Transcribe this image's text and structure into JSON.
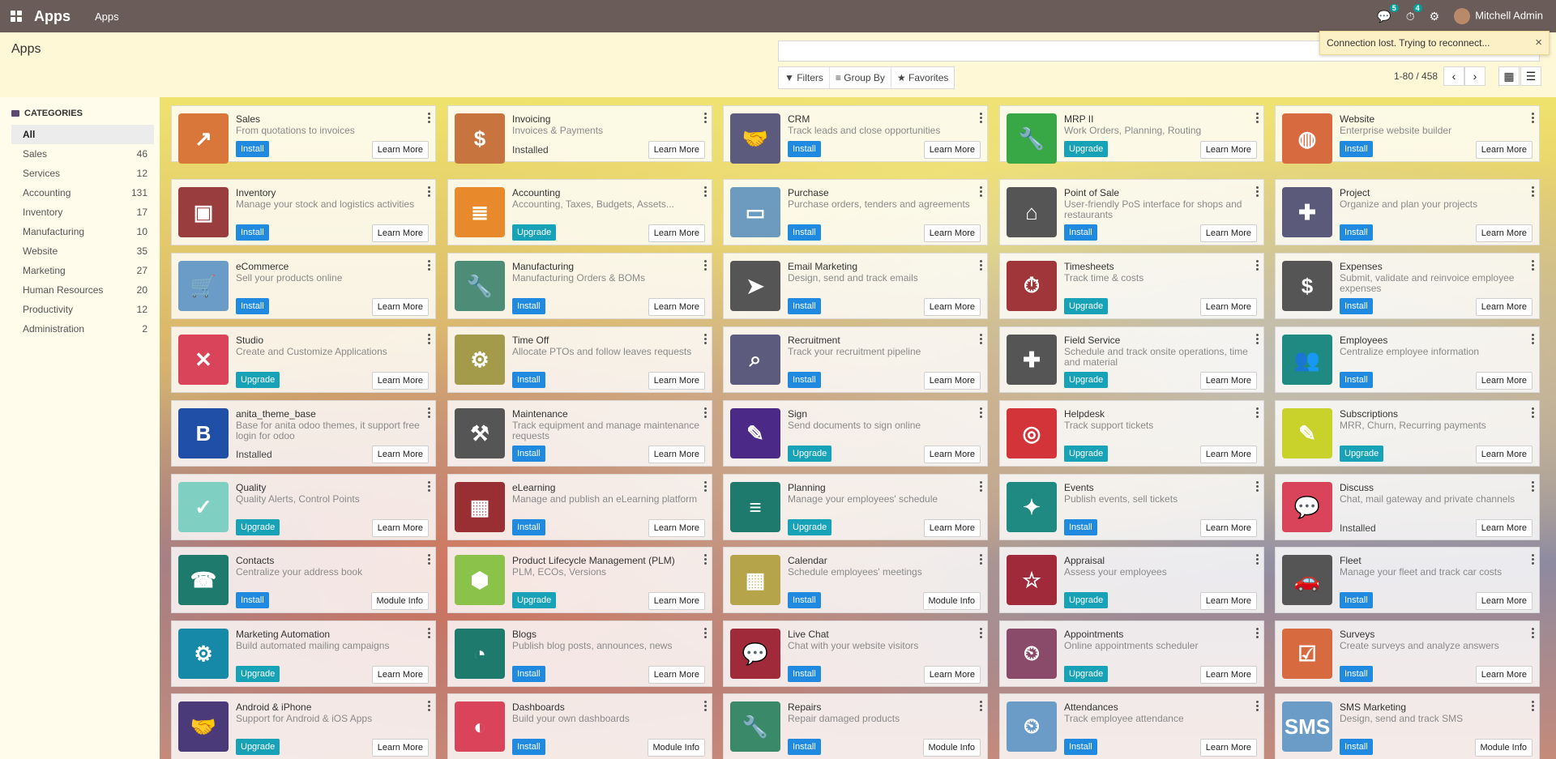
{
  "topbar": {
    "app_name": "Apps",
    "menu": "Apps",
    "messages_count": "5",
    "activities_count": "4",
    "user": "Mitchell Admin"
  },
  "control": {
    "title": "Apps",
    "filters": "Filters",
    "group_by": "Group By",
    "favorites": "Favorites",
    "pager": "1-80 / 458"
  },
  "toast": {
    "text": "Connection lost. Trying to reconnect..."
  },
  "sidebar": {
    "title": "CATEGORIES",
    "items": [
      {
        "label": "All",
        "count": ""
      },
      {
        "label": "Sales",
        "count": "46"
      },
      {
        "label": "Services",
        "count": "12"
      },
      {
        "label": "Accounting",
        "count": "131"
      },
      {
        "label": "Inventory",
        "count": "17"
      },
      {
        "label": "Manufacturing",
        "count": "10"
      },
      {
        "label": "Website",
        "count": "35"
      },
      {
        "label": "Marketing",
        "count": "27"
      },
      {
        "label": "Human Resources",
        "count": "20"
      },
      {
        "label": "Productivity",
        "count": "12"
      },
      {
        "label": "Administration",
        "count": "2"
      }
    ]
  },
  "apps": [
    {
      "name": "Sales",
      "desc": "From quotations to invoices",
      "action": "Install",
      "info": "Learn More",
      "color": "#d9763a",
      "icon": "chart-icon",
      "glyph": "↗"
    },
    {
      "name": "Invoicing",
      "desc": "Invoices & Payments",
      "action": "Installed",
      "info": "Learn More",
      "color": "#c8743f",
      "icon": "invoice-icon",
      "glyph": "$"
    },
    {
      "name": "CRM",
      "desc": "Track leads and close opportunities",
      "action": "Install",
      "info": "Learn More",
      "color": "#5d5b7d",
      "icon": "handshake-icon",
      "glyph": "🤝"
    },
    {
      "name": "MRP II",
      "desc": "Work Orders, Planning, Routing",
      "action": "Upgrade",
      "info": "Learn More",
      "color": "#37a845",
      "icon": "wrench-icon",
      "glyph": "🔧"
    },
    {
      "name": "Website",
      "desc": "Enterprise website builder",
      "action": "Install",
      "info": "Learn More",
      "color": "#d76a3e",
      "icon": "globe-icon",
      "glyph": "◍"
    },
    {
      "name": "Inventory",
      "desc": "Manage your stock and logistics activities",
      "action": "Install",
      "info": "Learn More",
      "color": "#9a3d3f",
      "icon": "box-icon",
      "glyph": "▣"
    },
    {
      "name": "Accounting",
      "desc": "Accounting, Taxes, Budgets, Assets...",
      "action": "Upgrade",
      "info": "Learn More",
      "color": "#e88a2b",
      "icon": "document-icon",
      "glyph": "≣"
    },
    {
      "name": "Purchase",
      "desc": "Purchase orders, tenders and agreements",
      "action": "Install",
      "info": "Learn More",
      "color": "#6d9bbf",
      "icon": "card-icon",
      "glyph": "▭"
    },
    {
      "name": "Point of Sale",
      "desc": "User-friendly PoS interface for shops and restaurants",
      "action": "Install",
      "info": "Learn More",
      "color": "#555555",
      "icon": "store-icon",
      "glyph": "⌂"
    },
    {
      "name": "Project",
      "desc": "Organize and plan your projects",
      "action": "Install",
      "info": "Learn More",
      "color": "#5b5a7a",
      "icon": "puzzle-icon",
      "glyph": "✚"
    },
    {
      "name": "eCommerce",
      "desc": "Sell your products online",
      "action": "Install",
      "info": "Learn More",
      "color": "#6a9cc7",
      "icon": "cart-icon",
      "glyph": "🛒"
    },
    {
      "name": "Manufacturing",
      "desc": "Manufacturing Orders & BOMs",
      "action": "Install",
      "info": "Learn More",
      "color": "#4d8d77",
      "icon": "wrench-icon",
      "glyph": "🔧"
    },
    {
      "name": "Email Marketing",
      "desc": "Design, send and track emails",
      "action": "Install",
      "info": "Learn More",
      "color": "#555555",
      "icon": "paper-plane-icon",
      "glyph": "➤"
    },
    {
      "name": "Timesheets",
      "desc": "Track time & costs",
      "action": "Upgrade",
      "info": "Learn More",
      "color": "#a0363a",
      "icon": "stopwatch-icon",
      "glyph": "⏱"
    },
    {
      "name": "Expenses",
      "desc": "Submit, validate and reinvoice employee expenses",
      "action": "Install",
      "info": "Learn More",
      "color": "#555555",
      "icon": "user-dollar-icon",
      "glyph": "$"
    },
    {
      "name": "Studio",
      "desc": "Create and Customize Applications",
      "action": "Upgrade",
      "info": "Learn More",
      "color": "#d9445a",
      "icon": "tools-icon",
      "glyph": "✕"
    },
    {
      "name": "Time Off",
      "desc": "Allocate PTOs and follow leaves requests",
      "action": "Install",
      "info": "Learn More",
      "color": "#a49b4a",
      "icon": "user-gear-icon",
      "glyph": "⚙"
    },
    {
      "name": "Recruitment",
      "desc": "Track your recruitment pipeline",
      "action": "Install",
      "info": "Learn More",
      "color": "#5d5b7d",
      "icon": "magnifier-icon",
      "glyph": "⌕"
    },
    {
      "name": "Field Service",
      "desc": "Schedule and track onsite operations, time and material",
      "action": "Upgrade",
      "info": "Learn More",
      "color": "#555555",
      "icon": "puzzle-clock-icon",
      "glyph": "✚"
    },
    {
      "name": "Employees",
      "desc": "Centralize employee information",
      "action": "Install",
      "info": "Learn More",
      "color": "#1f8a82",
      "icon": "users-icon",
      "glyph": "👥"
    },
    {
      "name": "anita_theme_base",
      "desc": "Base for anita odoo themes, it support free login for odoo",
      "action": "Installed",
      "info": "Learn More",
      "color": "#1f4fa6",
      "icon": "b-letter-icon",
      "glyph": "B"
    },
    {
      "name": "Maintenance",
      "desc": "Track equipment and manage maintenance requests",
      "action": "Install",
      "info": "Learn More",
      "color": "#555555",
      "icon": "hammer-icon",
      "glyph": "⚒"
    },
    {
      "name": "Sign",
      "desc": "Send documents to sign online",
      "action": "Upgrade",
      "info": "Learn More",
      "color": "#4a2a86",
      "icon": "sign-document-icon",
      "glyph": "✎"
    },
    {
      "name": "Helpdesk",
      "desc": "Track support tickets",
      "action": "Upgrade",
      "info": "Learn More",
      "color": "#d3343a",
      "icon": "lifebuoy-icon",
      "glyph": "◎"
    },
    {
      "name": "Subscriptions",
      "desc": "MRR, Churn, Recurring payments",
      "action": "Upgrade",
      "info": "Learn More",
      "color": "#c9d12b",
      "icon": "rss-pen-icon",
      "glyph": "✎"
    },
    {
      "name": "Quality",
      "desc": "Quality Alerts, Control Points",
      "action": "Upgrade",
      "info": "Learn More",
      "color": "#7fcfc2",
      "icon": "clipboard-check-icon",
      "glyph": "✓"
    },
    {
      "name": "eLearning",
      "desc": "Manage and publish an eLearning platform",
      "action": "Install",
      "info": "Learn More",
      "color": "#9a2f33",
      "icon": "teacher-icon",
      "glyph": "▦"
    },
    {
      "name": "Planning",
      "desc": "Manage your employees' schedule",
      "action": "Upgrade",
      "info": "Learn More",
      "color": "#1f7a6e",
      "icon": "planning-icon",
      "glyph": "≡"
    },
    {
      "name": "Events",
      "desc": "Publish events, sell tickets",
      "action": "Install",
      "info": "Learn More",
      "color": "#1f8a82",
      "icon": "ticket-icon",
      "glyph": "✦"
    },
    {
      "name": "Discuss",
      "desc": "Chat, mail gateway and private channels",
      "action": "Installed",
      "info": "Learn More",
      "color": "#d9445a",
      "icon": "chat-icon",
      "glyph": "💬"
    },
    {
      "name": "Contacts",
      "desc": "Centralize your address book",
      "action": "Install",
      "info": "Module Info",
      "color": "#1f7a6e",
      "icon": "address-book-icon",
      "glyph": "☎"
    },
    {
      "name": "Product Lifecycle Management (PLM)",
      "desc": "PLM, ECOs, Versions",
      "action": "Upgrade",
      "info": "Learn More",
      "color": "#8bc34a",
      "icon": "cube-icon",
      "glyph": "⬢"
    },
    {
      "name": "Calendar",
      "desc": "Schedule employees' meetings",
      "action": "Install",
      "info": "Module Info",
      "color": "#b5a44a",
      "icon": "calendar-icon",
      "glyph": "▦"
    },
    {
      "name": "Appraisal",
      "desc": "Assess your employees",
      "action": "Upgrade",
      "info": "Learn More",
      "color": "#a02a3a",
      "icon": "star-icon",
      "glyph": "☆"
    },
    {
      "name": "Fleet",
      "desc": "Manage your fleet and track car costs",
      "action": "Install",
      "info": "Learn More",
      "color": "#555555",
      "icon": "car-icon",
      "glyph": "🚗"
    },
    {
      "name": "Marketing Automation",
      "desc": "Build automated mailing campaigns",
      "action": "Upgrade",
      "info": "Learn More",
      "color": "#1688a8",
      "icon": "envelope-gear-icon",
      "glyph": "⚙"
    },
    {
      "name": "Blogs",
      "desc": "Publish blog posts, announces, news",
      "action": "Install",
      "info": "Learn More",
      "color": "#1f7a6e",
      "icon": "rss-icon",
      "glyph": "◔"
    },
    {
      "name": "Live Chat",
      "desc": "Chat with your website visitors",
      "action": "Install",
      "info": "Learn More",
      "color": "#a02a3a",
      "icon": "chat-bubbles-icon",
      "glyph": "💬"
    },
    {
      "name": "Appointments",
      "desc": "Online appointments scheduler",
      "action": "Upgrade",
      "info": "Learn More",
      "color": "#8a4a6a",
      "icon": "calendar-clock-icon",
      "glyph": "⏲"
    },
    {
      "name": "Surveys",
      "desc": "Create surveys and analyze answers",
      "action": "Install",
      "info": "Learn More",
      "color": "#d76a3e",
      "icon": "checklist-icon",
      "glyph": "☑"
    },
    {
      "name": "Android & iPhone",
      "desc": "Support for Android & iOS Apps",
      "action": "Upgrade",
      "info": "Learn More",
      "color": "#4a3a7a",
      "icon": "handshake-icon",
      "glyph": "🤝"
    },
    {
      "name": "Dashboards",
      "desc": "Build your own dashboards",
      "action": "Install",
      "info": "Module Info",
      "color": "#d9445a",
      "icon": "gauge-icon",
      "glyph": "◐"
    },
    {
      "name": "Repairs",
      "desc": "Repair damaged products",
      "action": "Install",
      "info": "Module Info",
      "color": "#3a8a6a",
      "icon": "wrench-gear-icon",
      "glyph": "🔧"
    },
    {
      "name": "Attendances",
      "desc": "Track employee attendance",
      "action": "Install",
      "info": "Learn More",
      "color": "#6a9cc7",
      "icon": "user-clock-icon",
      "glyph": "⏲"
    },
    {
      "name": "SMS Marketing",
      "desc": "Design, send and track SMS",
      "action": "Install",
      "info": "Module Info",
      "color": "#6a9cc7",
      "icon": "sms-icon",
      "glyph": "SMS"
    }
  ]
}
